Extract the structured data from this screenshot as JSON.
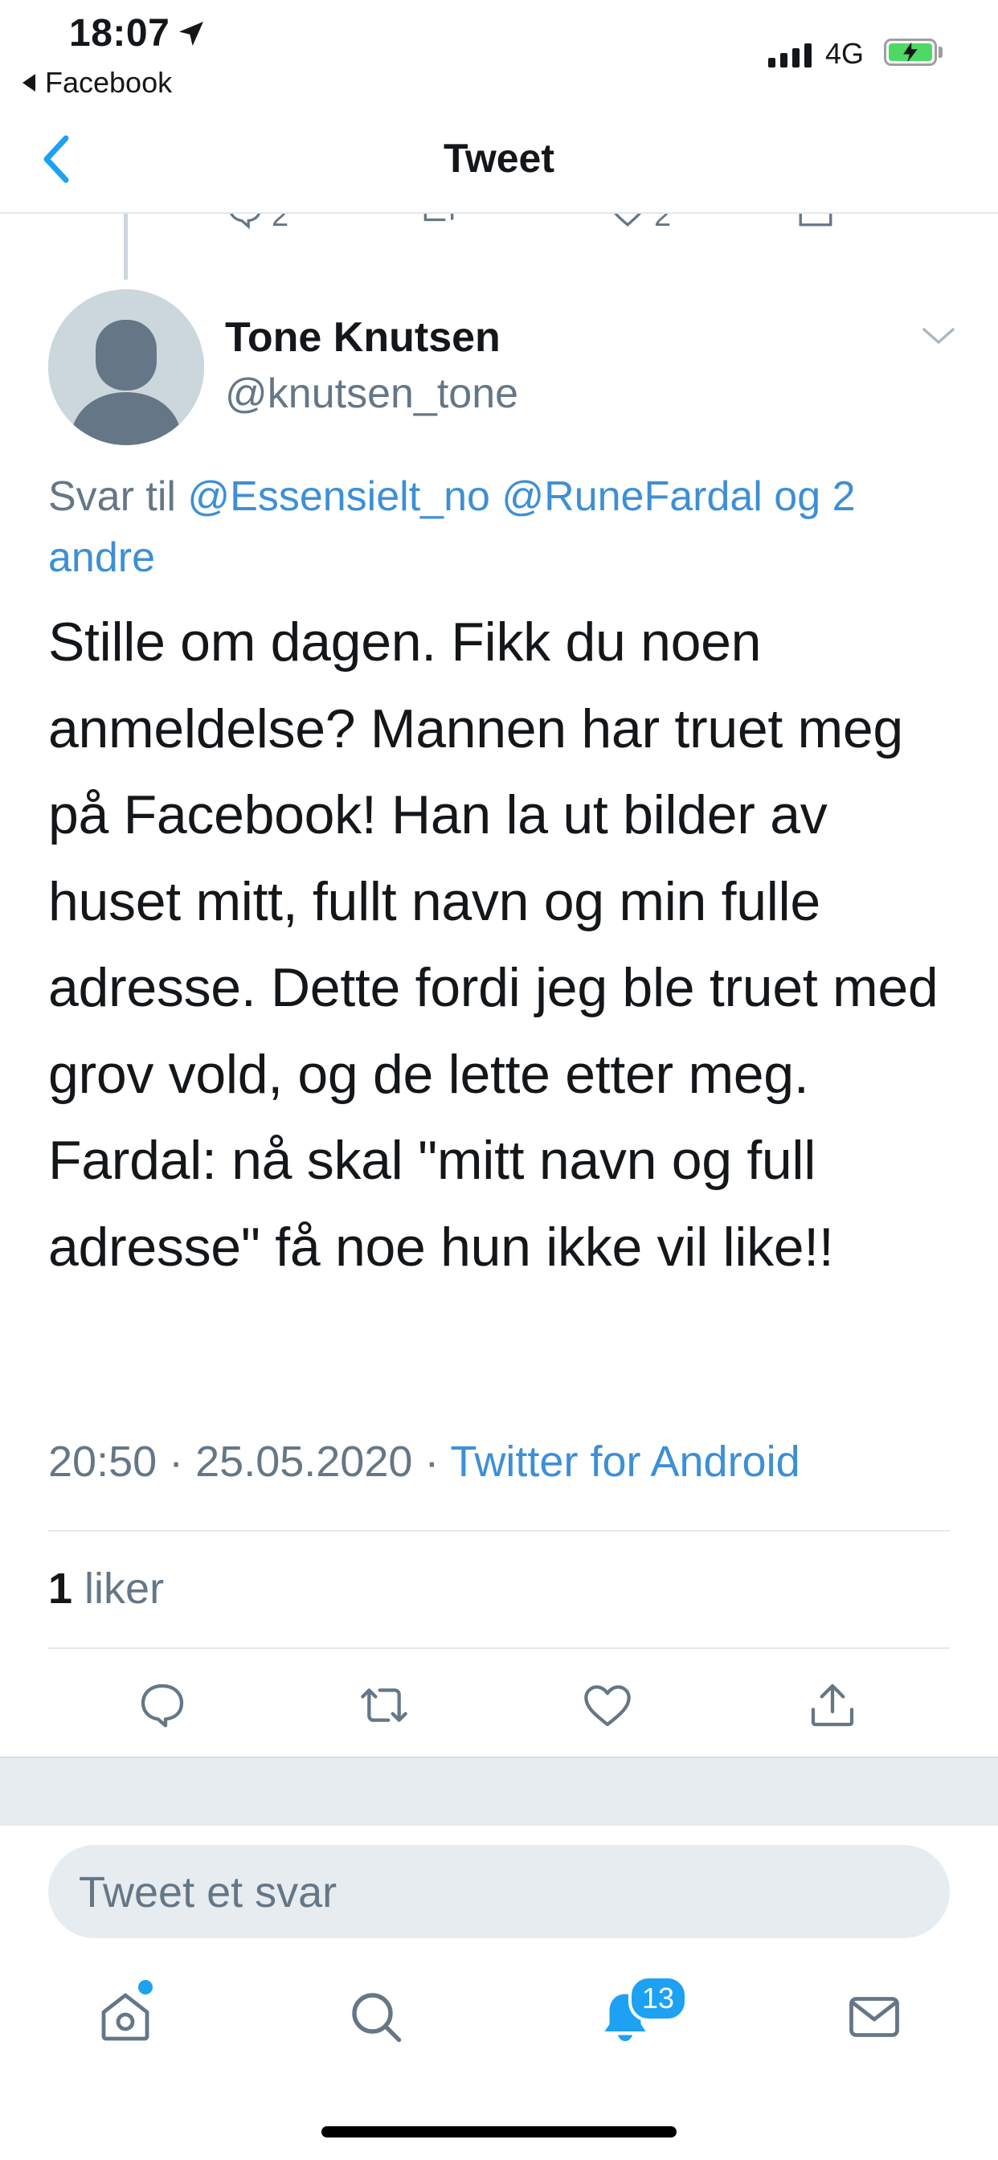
{
  "status_bar": {
    "time": "18:07",
    "back_app": "Facebook",
    "network": "4G"
  },
  "nav": {
    "title": "Tweet"
  },
  "tweet": {
    "author_name": "Tone Knutsen",
    "author_handle": "@knutsen_tone",
    "reply_prefix": "Svar til ",
    "reply_mentions": "@Essensielt_no @RuneFardal og 2 andre",
    "text": "Stille om dagen. Fikk du noen anmeldelse? Mannen har truet meg på Facebook! Han la ut bilder av huset mitt, fullt navn og min fulle adresse. Dette fordi jeg ble truet med grov vold, og de lette etter meg. Fardal: nå skal \"mitt navn og full adresse\" få noe hun ikke vil like!!",
    "time": "20:50",
    "date": "25.05.2020",
    "separator": " · ",
    "source": "Twitter for Android",
    "likes_count": "1",
    "likes_label": " liker"
  },
  "previous_tweet": {
    "reply_count": "2",
    "like_count": "2"
  },
  "reply_box": {
    "placeholder": "Tweet et svar"
  },
  "tab_bar": {
    "notifications_badge": "13"
  },
  "colors": {
    "link": "#3d8fd6",
    "secondary_text": "#657786",
    "accent": "#1da1f2",
    "divider": "#e1e8ed"
  },
  "icons": {
    "nav_back": "chevron-left-icon",
    "menu": "chevron-down-icon",
    "actions": [
      "reply-icon",
      "retweet-icon",
      "like-icon",
      "share-icon"
    ],
    "tabs": [
      "home-icon",
      "search-icon",
      "notifications-icon",
      "messages-icon"
    ]
  }
}
